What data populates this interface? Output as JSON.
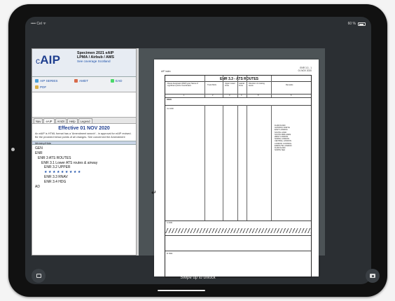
{
  "status": {
    "left": "•••• Cel ᯤ",
    "right": "60 %"
  },
  "app": {
    "logo": "AIP",
    "logo_prefix": "c",
    "header": {
      "title": "Specimen 2021 eAIP",
      "line2": "LPMA / Airbub / AMS",
      "line3": "See coverage Scotland",
      "link": "See coverage Scotland"
    },
    "quicklinks": [
      {
        "label": "AIP SERIES",
        "color": "#4aa0d8"
      },
      {
        "label": "AMDT",
        "color": "#d86a4a"
      },
      {
        "label": "PDF",
        "color": "#d8b04a"
      },
      {
        "label": "EAD",
        "color": "#4ad86a"
      }
    ],
    "tabs": [
      "Nav",
      "eAIP",
      "AmDt",
      "Help",
      "Legend"
    ],
    "active_tab": 1,
    "effective_title": "Effective 01 NOV 2020",
    "effective_note": "An eAIP is HTML format has a 'Amendment search' - in approval for eAIP revised. Be the provided below points of all changes. See concerned the Amendment",
    "nav_label": "Ministry/Hide",
    "tree": [
      {
        "text": "GEN",
        "level": 0
      },
      {
        "text": "ENR",
        "level": 0
      },
      {
        "text": "ENR 3 ATS ROUTES",
        "level": 1
      },
      {
        "text": "ENR 3.1 Lower ATS routes & airway",
        "level": 2
      },
      {
        "text": "ENR 3.2 UPPER",
        "level": 3
      },
      {
        "text": "★★★★★★★★★",
        "level": 3,
        "stars": true
      },
      {
        "text": "ENR 3.3 RNAV",
        "level": 3
      },
      {
        "text": "ENR 3.4 HDG",
        "level": 3
      },
      {
        "text": "AD",
        "level": 0
      }
    ]
  },
  "document": {
    "title": "ENR 3.3 - ATS ROUTES",
    "head_left": "AIP Index",
    "head_right_1": "ENR 3.3 - 1",
    "head_right_2": "01 NOV 2020",
    "column_headers": [
      "Route designator (RNP type) Name of significant points Coordinates",
      "Track MAG",
      "Upper Lower limits",
      "Lateral limits",
      "Direction of cruising levels",
      "Remarks"
    ],
    "column_numbers": [
      "1",
      "2",
      "3",
      "4",
      "5",
      "6"
    ],
    "row_labels": [
      "RNAV",
      "UL 1000",
      "A 1300",
      "B 7000"
    ],
    "remarks_list": [
      "FL000 FL660",
      "GATWICK NORTH",
      "EAST LONDON",
      "SOUTH LOND",
      "SOUTH MIDLANDS",
      "WEST LONDON",
      "NORTH LONDON",
      "CENTRAL LONDON",
      "LONDON CONTROL",
      "ENROUTE LONDON",
      "FL000 FL660",
      "NORTH SEA"
    ]
  },
  "lock": {
    "swipe_text": "Swipe up to unlock"
  }
}
